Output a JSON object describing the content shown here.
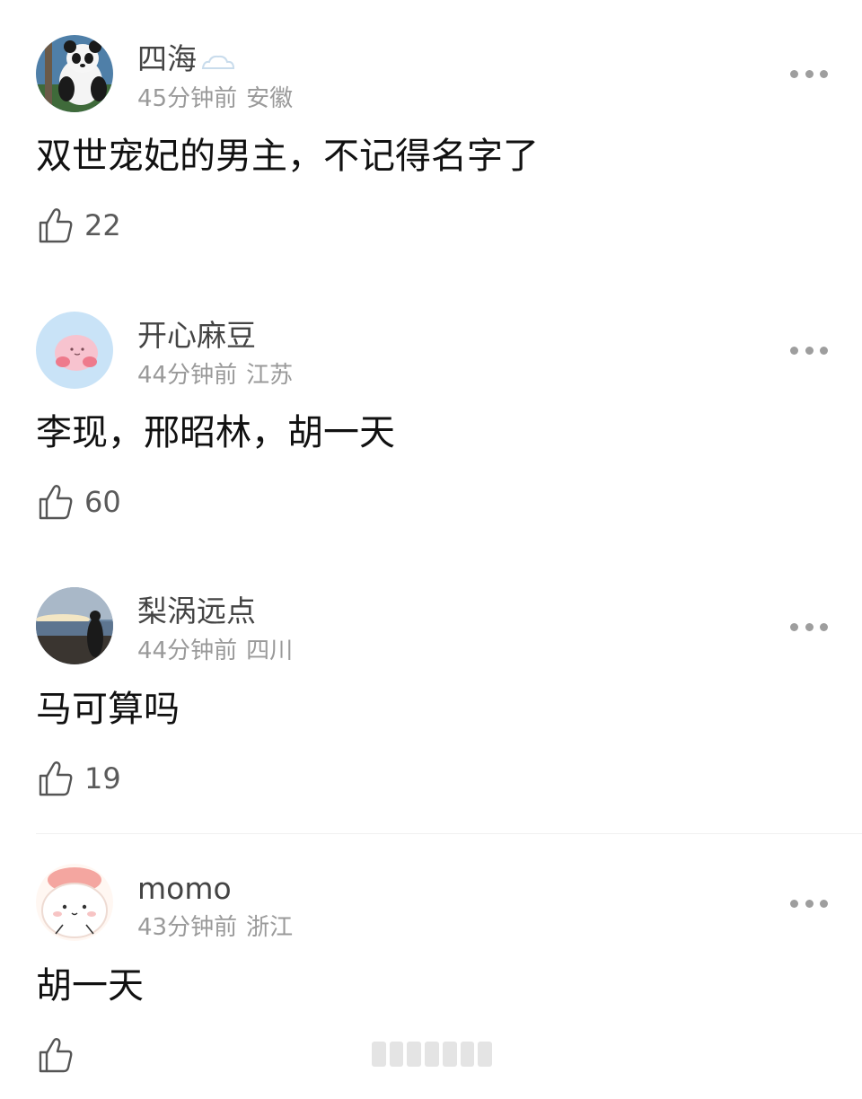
{
  "comments": [
    {
      "username": "四海",
      "time": "45分钟前",
      "location": "安徽",
      "text": "双世宠妃的男主，不记得名字了",
      "likes": "22",
      "avatar_icon": "panda-avatar-icon",
      "badge_icon": "cloud-badge-icon"
    },
    {
      "username": "开心麻豆",
      "time": "44分钟前",
      "location": "江苏",
      "text": "李现，邢昭林，胡一天",
      "likes": "60",
      "avatar_icon": "pink-blob-avatar-icon"
    },
    {
      "username": "梨涡远点",
      "time": "44分钟前",
      "location": "四川",
      "text": "马可算吗",
      "likes": "19",
      "avatar_icon": "sunset-photo-avatar-icon"
    },
    {
      "username": "momo",
      "time": "43分钟前",
      "location": "浙江",
      "text": "胡一天",
      "likes": "",
      "avatar_icon": "cute-bun-avatar-icon"
    }
  ],
  "colors": {
    "username": "#444444",
    "meta": "#9a9a9a",
    "text": "#111111",
    "icon": "#555555"
  }
}
